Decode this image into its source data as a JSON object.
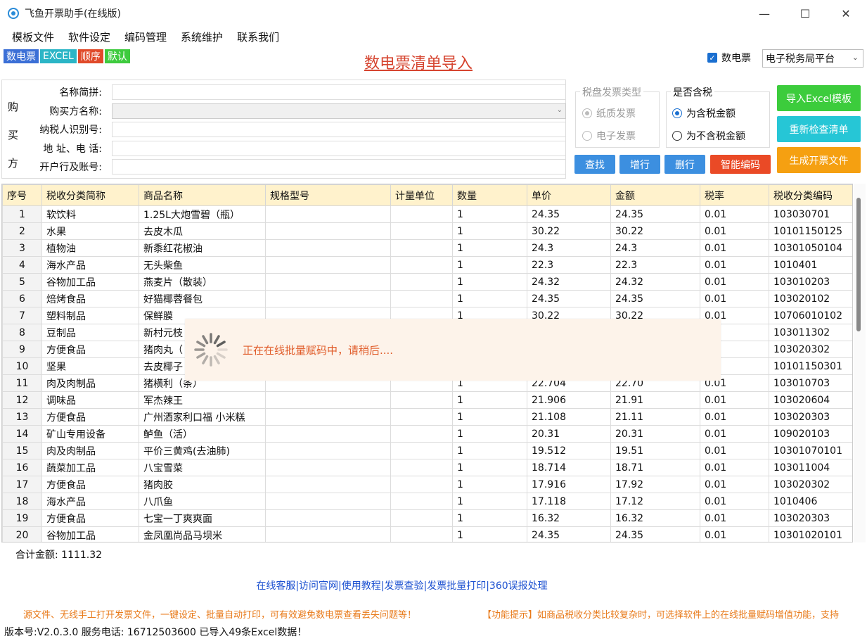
{
  "window": {
    "title": "飞鱼开票助手(在线版)",
    "minimize": "—",
    "maximize": "☐",
    "close": "✕"
  },
  "menu": [
    "模板文件",
    "软件设定",
    "编码管理",
    "系统维护",
    "联系我们"
  ],
  "tags": [
    {
      "label": "数电票",
      "color": "#3b6fd6"
    },
    {
      "label": "EXCEL",
      "color": "#2bb5c6"
    },
    {
      "label": "顺序",
      "color": "#e04a2a"
    },
    {
      "label": "默认",
      "color": "#3ecb3e"
    }
  ],
  "page_title": "数电票清单导入",
  "top_checkbox": {
    "label": "数电票",
    "checked": true
  },
  "platform_select": {
    "value": "电子税务局平台"
  },
  "buyer": {
    "side_label": [
      "购",
      "买",
      "方"
    ],
    "fields": [
      {
        "label": "名称简拼:",
        "value": ""
      },
      {
        "label": "购买方名称:",
        "value": ""
      },
      {
        "label": "纳税人识别号:",
        "value": ""
      },
      {
        "label": "地 址、电 话:",
        "value": ""
      },
      {
        "label": "开户行及账号:",
        "value": ""
      }
    ]
  },
  "invoice_type": {
    "title": "税盘发票类型",
    "options": [
      "纸质发票",
      "电子发票"
    ],
    "selected": 0,
    "enabled": false
  },
  "tax_included": {
    "title": "是否含税",
    "options": [
      "为含税金额",
      "为不含税金额"
    ],
    "selected": 0
  },
  "buttons": {
    "find": "查找",
    "add_row": "增行",
    "delete_row": "删行",
    "smart_code": "智能编码",
    "import_excel": "导入Excel模板",
    "recheck": "重新检查清单",
    "generate": "生成开票文件"
  },
  "colors": {
    "blue_btn": "#3c8fe0",
    "red_btn": "#ea4a26",
    "green_btn": "#3ccc3c",
    "cyan_btn": "#26c6d6",
    "orange_btn": "#f5a011"
  },
  "table": {
    "columns": [
      "序号",
      "税收分类简称",
      "商品名称",
      "规格型号",
      "计量单位",
      "数量",
      "单价",
      "金额",
      "税率",
      "税收分类编码"
    ],
    "rows": [
      [
        "1",
        "软饮料",
        "1.25L大炮雪碧（瓶）",
        "",
        "",
        "1",
        "24.35",
        "24.35",
        "0.01",
        "103030701"
      ],
      [
        "2",
        "水果",
        "去皮木瓜",
        "",
        "",
        "1",
        "30.22",
        "30.22",
        "0.01",
        "10101150125"
      ],
      [
        "3",
        "植物油",
        "新黍红花椒油",
        "",
        "",
        "1",
        "24.3",
        "24.3",
        "0.01",
        "10301050104"
      ],
      [
        "4",
        "海水产品",
        "无头柴鱼",
        "",
        "",
        "1",
        "22.3",
        "22.3",
        "0.01",
        "1010401"
      ],
      [
        "5",
        "谷物加工品",
        "燕麦片（散装）",
        "",
        "",
        "1",
        "24.32",
        "24.32",
        "0.01",
        "103010203"
      ],
      [
        "6",
        "焙烤食品",
        "好猫椰蓉餐包",
        "",
        "",
        "1",
        "24.35",
        "24.35",
        "0.01",
        "103020102"
      ],
      [
        "7",
        "塑料制品",
        "保鲜膜",
        "",
        "",
        "1",
        "30.22",
        "30.22",
        "0.01",
        "10706010102"
      ],
      [
        "8",
        "豆制品",
        "新村元枝",
        "",
        "",
        "",
        "",
        "",
        "",
        "103011302"
      ],
      [
        "9",
        "方便食品",
        "猪肉丸（",
        "",
        "",
        "",
        "",
        "",
        "",
        "103020302"
      ],
      [
        "10",
        "坚果",
        "去皮椰子",
        "",
        "",
        "",
        "",
        "",
        "",
        "10101150301"
      ],
      [
        "11",
        "肉及肉制品",
        "猪横利（条）",
        "",
        "",
        "1",
        "22.704",
        "22.70",
        "0.01",
        "103010703"
      ],
      [
        "12",
        "调味品",
        "军杰辣王",
        "",
        "",
        "1",
        "21.906",
        "21.91",
        "0.01",
        "103020604"
      ],
      [
        "13",
        "方便食品",
        "广州酒家利口福 小米糕",
        "",
        "",
        "1",
        "21.108",
        "21.11",
        "0.01",
        "103020303"
      ],
      [
        "14",
        "矿山专用设备",
        "鲈鱼（活）",
        "",
        "",
        "1",
        "20.31",
        "20.31",
        "0.01",
        "109020103"
      ],
      [
        "15",
        "肉及肉制品",
        "平价三黄鸡(去油肺)",
        "",
        "",
        "1",
        "19.512",
        "19.51",
        "0.01",
        "10301070101"
      ],
      [
        "16",
        "蔬菜加工品",
        "八宝雪菜",
        "",
        "",
        "1",
        "18.714",
        "18.71",
        "0.01",
        "103011004"
      ],
      [
        "17",
        "方便食品",
        "猪肉胶",
        "",
        "",
        "1",
        "17.916",
        "17.92",
        "0.01",
        "103020302"
      ],
      [
        "18",
        "海水产品",
        "八爪鱼",
        "",
        "",
        "1",
        "17.118",
        "17.12",
        "0.01",
        "1010406"
      ],
      [
        "19",
        "方便食品",
        "七宝一丁爽爽面",
        "",
        "",
        "1",
        "16.32",
        "16.32",
        "0.01",
        "103020303"
      ],
      [
        "20",
        "谷物加工品",
        "金凤凰尚品马坝米",
        "",
        "",
        "1",
        "24.35",
        "24.35",
        "0.01",
        "10301020101"
      ]
    ]
  },
  "loading_text": "正在在线批量赋码中，请稍后....",
  "total": {
    "label": "合计金额:",
    "value": "1111.32"
  },
  "links": "在线客服|访问官网|使用教程|发票查验|发票批量打印|360误报处理",
  "marquee": {
    "left": "源文件、无线手工打开发票文件，一键设定、批量自动打印，可有效避免数电票查看丢失问题等！",
    "right": "【功能提示】如商品税收分类比较复杂时，可选择软件上的在线批量赋码增值功能，支持"
  },
  "status": "版本号:V2.0.3.0  服务电话: 16712503600  已导入49条Excel数据！"
}
